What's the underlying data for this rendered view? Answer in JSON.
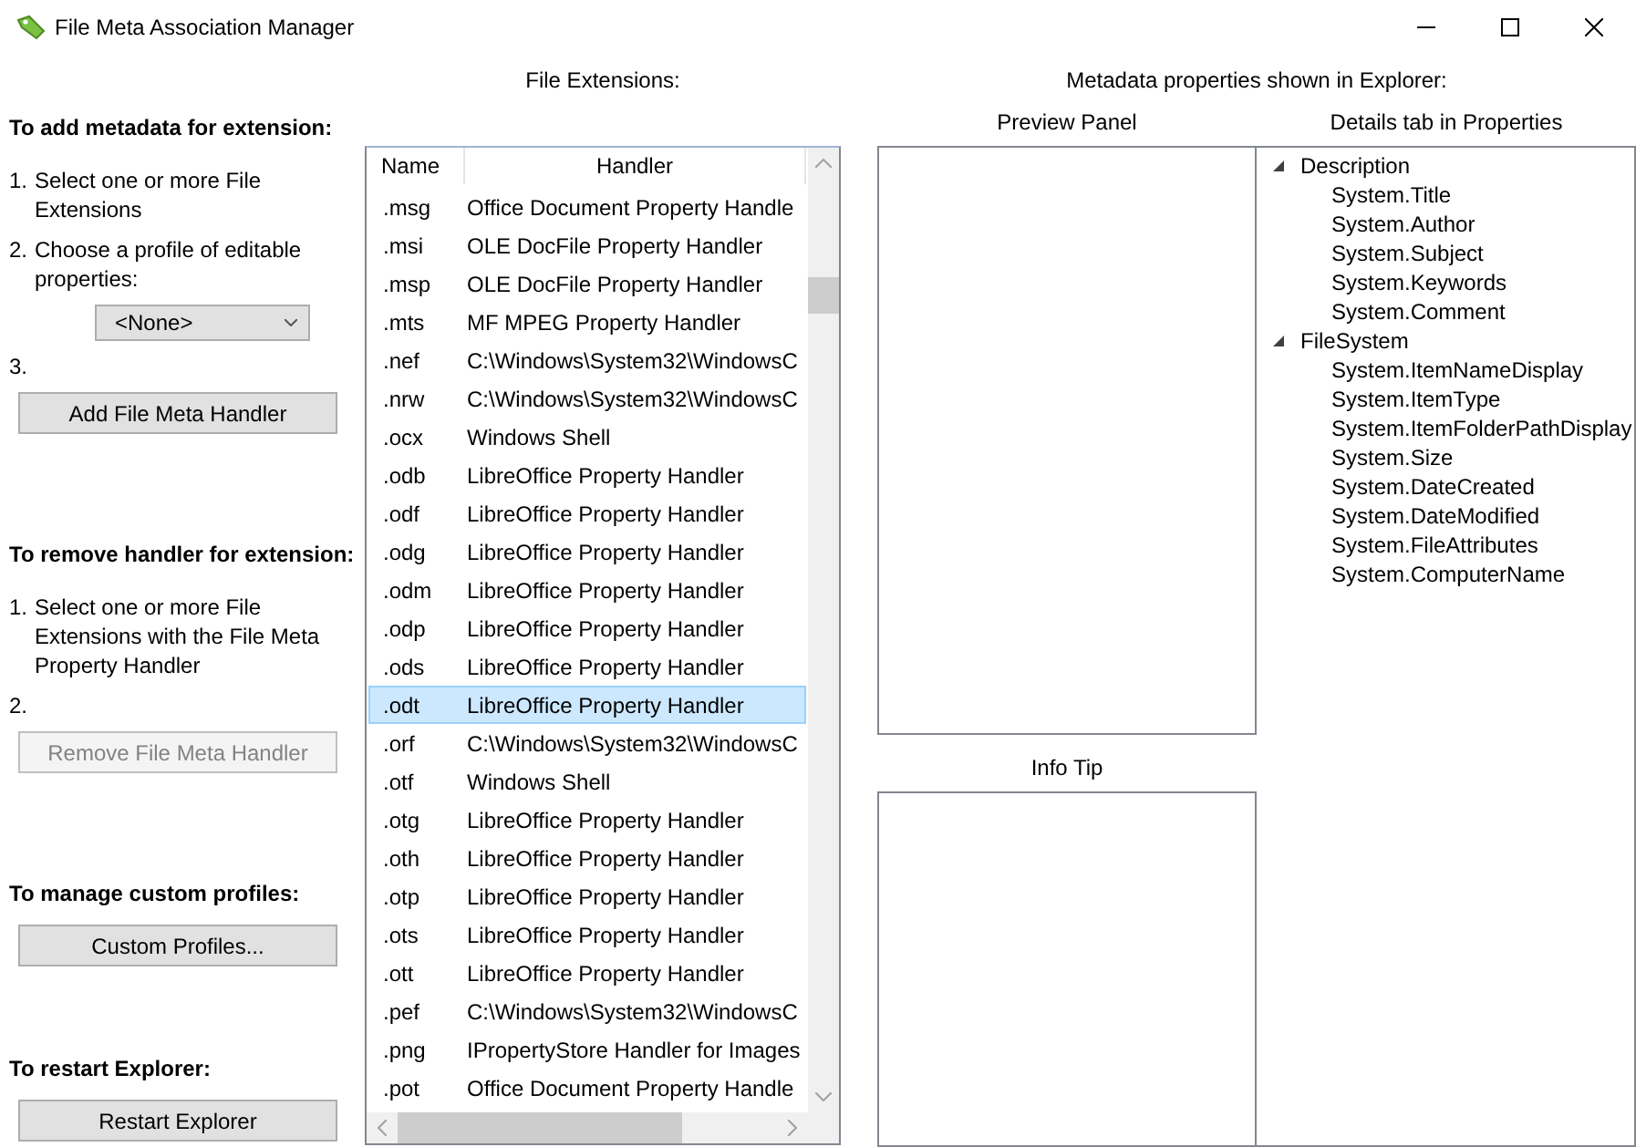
{
  "window": {
    "title": "File Meta Association Manager"
  },
  "left_sections": [
    {
      "heading": "To add metadata for extension:",
      "items": [
        {
          "kind": "step",
          "number": "1.",
          "text": "Select one or more File Extensions"
        },
        {
          "kind": "step",
          "number": "2.",
          "text": "Choose a profile of editable properties:"
        },
        {
          "kind": "dropdown",
          "value": "<None>"
        },
        {
          "kind": "step",
          "number": "3."
        },
        {
          "kind": "button",
          "label": "Add File Meta Handler",
          "disabled": false
        }
      ]
    },
    {
      "heading": "To remove handler for extension:",
      "items": [
        {
          "kind": "step",
          "number": "1.",
          "text": "Select one or more File Extensions with the File Meta Property Handler"
        },
        {
          "kind": "step",
          "number": "2."
        },
        {
          "kind": "button",
          "label": "Remove File Meta Handler",
          "disabled": true
        }
      ]
    },
    {
      "heading": "To manage custom profiles:",
      "items": [
        {
          "kind": "button",
          "label": "Custom Profiles...",
          "disabled": false
        }
      ]
    },
    {
      "heading": "To restart Explorer:",
      "items": [
        {
          "kind": "button",
          "label": "Restart Explorer",
          "disabled": false
        }
      ]
    }
  ],
  "extensions": {
    "title": "File Extensions:",
    "columns": [
      "Name",
      "Handler"
    ],
    "rows": [
      {
        "name": ".msg",
        "handler": "Office Document Property Handle",
        "selected": false
      },
      {
        "name": ".msi",
        "handler": "OLE DocFile Property Handler",
        "selected": false
      },
      {
        "name": ".msp",
        "handler": "OLE DocFile Property Handler",
        "selected": false
      },
      {
        "name": ".mts",
        "handler": "MF MPEG Property Handler",
        "selected": false
      },
      {
        "name": ".nef",
        "handler": "C:\\Windows\\System32\\WindowsC",
        "selected": false
      },
      {
        "name": ".nrw",
        "handler": "C:\\Windows\\System32\\WindowsC",
        "selected": false
      },
      {
        "name": ".ocx",
        "handler": "Windows Shell",
        "selected": false
      },
      {
        "name": ".odb",
        "handler": "LibreOffice Property Handler",
        "selected": false
      },
      {
        "name": ".odf",
        "handler": "LibreOffice Property Handler",
        "selected": false
      },
      {
        "name": ".odg",
        "handler": "LibreOffice Property Handler",
        "selected": false
      },
      {
        "name": ".odm",
        "handler": "LibreOffice Property Handler",
        "selected": false
      },
      {
        "name": ".odp",
        "handler": "LibreOffice Property Handler",
        "selected": false
      },
      {
        "name": ".ods",
        "handler": "LibreOffice Property Handler",
        "selected": false
      },
      {
        "name": ".odt",
        "handler": "LibreOffice Property Handler",
        "selected": true
      },
      {
        "name": ".orf",
        "handler": "C:\\Windows\\System32\\WindowsC",
        "selected": false
      },
      {
        "name": ".otf",
        "handler": "Windows Shell",
        "selected": false
      },
      {
        "name": ".otg",
        "handler": "LibreOffice Property Handler",
        "selected": false
      },
      {
        "name": ".oth",
        "handler": "LibreOffice Property Handler",
        "selected": false
      },
      {
        "name": ".otp",
        "handler": "LibreOffice Property Handler",
        "selected": false
      },
      {
        "name": ".ots",
        "handler": "LibreOffice Property Handler",
        "selected": false
      },
      {
        "name": ".ott",
        "handler": "LibreOffice Property Handler",
        "selected": false
      },
      {
        "name": ".pef",
        "handler": "C:\\Windows\\System32\\WindowsC",
        "selected": false
      },
      {
        "name": ".png",
        "handler": "IPropertyStore Handler for Images",
        "selected": false
      },
      {
        "name": ".pot",
        "handler": "Office Document Property Handle",
        "selected": false
      }
    ]
  },
  "metadata": {
    "title": "Metadata properties shown in Explorer:",
    "preview_panel": {
      "title": "Preview Panel"
    },
    "info_tip": {
      "title": "Info Tip"
    },
    "details": {
      "title": "Details tab in Properties",
      "tree": [
        {
          "label": "Description",
          "expanded": true,
          "children": [
            {
              "label": "System.Title"
            },
            {
              "label": "System.Author"
            },
            {
              "label": "System.Subject"
            },
            {
              "label": "System.Keywords"
            },
            {
              "label": "System.Comment"
            }
          ]
        },
        {
          "label": "FileSystem",
          "expanded": true,
          "children": [
            {
              "label": "System.ItemNameDisplay"
            },
            {
              "label": "System.ItemType"
            },
            {
              "label": "System.ItemFolderPathDisplay"
            },
            {
              "label": "System.Size"
            },
            {
              "label": "System.DateCreated"
            },
            {
              "label": "System.DateModified"
            },
            {
              "label": "System.FileAttributes"
            },
            {
              "label": "System.ComputerName"
            }
          ]
        }
      ]
    }
  }
}
